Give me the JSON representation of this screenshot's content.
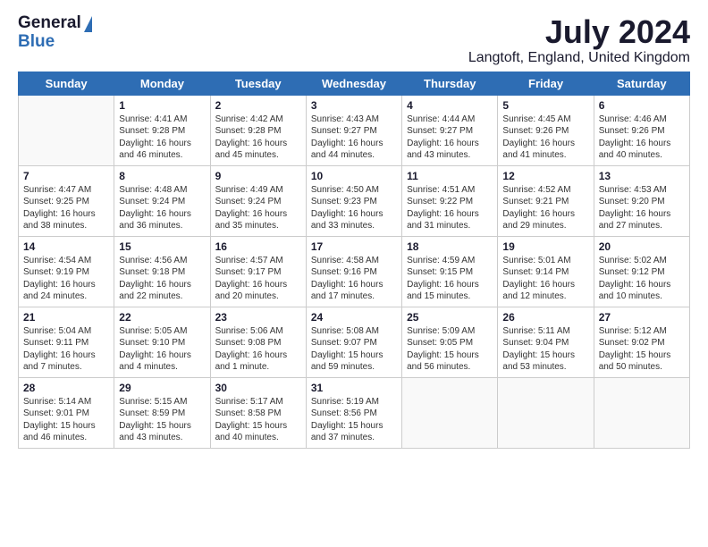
{
  "header": {
    "logo_general": "General",
    "logo_blue": "Blue",
    "month_title": "July 2024",
    "location": "Langtoft, England, United Kingdom"
  },
  "days_of_week": [
    "Sunday",
    "Monday",
    "Tuesday",
    "Wednesday",
    "Thursday",
    "Friday",
    "Saturday"
  ],
  "weeks": [
    [
      {
        "day": "",
        "info": ""
      },
      {
        "day": "1",
        "info": "Sunrise: 4:41 AM\nSunset: 9:28 PM\nDaylight: 16 hours\nand 46 minutes."
      },
      {
        "day": "2",
        "info": "Sunrise: 4:42 AM\nSunset: 9:28 PM\nDaylight: 16 hours\nand 45 minutes."
      },
      {
        "day": "3",
        "info": "Sunrise: 4:43 AM\nSunset: 9:27 PM\nDaylight: 16 hours\nand 44 minutes."
      },
      {
        "day": "4",
        "info": "Sunrise: 4:44 AM\nSunset: 9:27 PM\nDaylight: 16 hours\nand 43 minutes."
      },
      {
        "day": "5",
        "info": "Sunrise: 4:45 AM\nSunset: 9:26 PM\nDaylight: 16 hours\nand 41 minutes."
      },
      {
        "day": "6",
        "info": "Sunrise: 4:46 AM\nSunset: 9:26 PM\nDaylight: 16 hours\nand 40 minutes."
      }
    ],
    [
      {
        "day": "7",
        "info": "Sunrise: 4:47 AM\nSunset: 9:25 PM\nDaylight: 16 hours\nand 38 minutes."
      },
      {
        "day": "8",
        "info": "Sunrise: 4:48 AM\nSunset: 9:24 PM\nDaylight: 16 hours\nand 36 minutes."
      },
      {
        "day": "9",
        "info": "Sunrise: 4:49 AM\nSunset: 9:24 PM\nDaylight: 16 hours\nand 35 minutes."
      },
      {
        "day": "10",
        "info": "Sunrise: 4:50 AM\nSunset: 9:23 PM\nDaylight: 16 hours\nand 33 minutes."
      },
      {
        "day": "11",
        "info": "Sunrise: 4:51 AM\nSunset: 9:22 PM\nDaylight: 16 hours\nand 31 minutes."
      },
      {
        "day": "12",
        "info": "Sunrise: 4:52 AM\nSunset: 9:21 PM\nDaylight: 16 hours\nand 29 minutes."
      },
      {
        "day": "13",
        "info": "Sunrise: 4:53 AM\nSunset: 9:20 PM\nDaylight: 16 hours\nand 27 minutes."
      }
    ],
    [
      {
        "day": "14",
        "info": "Sunrise: 4:54 AM\nSunset: 9:19 PM\nDaylight: 16 hours\nand 24 minutes."
      },
      {
        "day": "15",
        "info": "Sunrise: 4:56 AM\nSunset: 9:18 PM\nDaylight: 16 hours\nand 22 minutes."
      },
      {
        "day": "16",
        "info": "Sunrise: 4:57 AM\nSunset: 9:17 PM\nDaylight: 16 hours\nand 20 minutes."
      },
      {
        "day": "17",
        "info": "Sunrise: 4:58 AM\nSunset: 9:16 PM\nDaylight: 16 hours\nand 17 minutes."
      },
      {
        "day": "18",
        "info": "Sunrise: 4:59 AM\nSunset: 9:15 PM\nDaylight: 16 hours\nand 15 minutes."
      },
      {
        "day": "19",
        "info": "Sunrise: 5:01 AM\nSunset: 9:14 PM\nDaylight: 16 hours\nand 12 minutes."
      },
      {
        "day": "20",
        "info": "Sunrise: 5:02 AM\nSunset: 9:12 PM\nDaylight: 16 hours\nand 10 minutes."
      }
    ],
    [
      {
        "day": "21",
        "info": "Sunrise: 5:04 AM\nSunset: 9:11 PM\nDaylight: 16 hours\nand 7 minutes."
      },
      {
        "day": "22",
        "info": "Sunrise: 5:05 AM\nSunset: 9:10 PM\nDaylight: 16 hours\nand 4 minutes."
      },
      {
        "day": "23",
        "info": "Sunrise: 5:06 AM\nSunset: 9:08 PM\nDaylight: 16 hours\nand 1 minute."
      },
      {
        "day": "24",
        "info": "Sunrise: 5:08 AM\nSunset: 9:07 PM\nDaylight: 15 hours\nand 59 minutes."
      },
      {
        "day": "25",
        "info": "Sunrise: 5:09 AM\nSunset: 9:05 PM\nDaylight: 15 hours\nand 56 minutes."
      },
      {
        "day": "26",
        "info": "Sunrise: 5:11 AM\nSunset: 9:04 PM\nDaylight: 15 hours\nand 53 minutes."
      },
      {
        "day": "27",
        "info": "Sunrise: 5:12 AM\nSunset: 9:02 PM\nDaylight: 15 hours\nand 50 minutes."
      }
    ],
    [
      {
        "day": "28",
        "info": "Sunrise: 5:14 AM\nSunset: 9:01 PM\nDaylight: 15 hours\nand 46 minutes."
      },
      {
        "day": "29",
        "info": "Sunrise: 5:15 AM\nSunset: 8:59 PM\nDaylight: 15 hours\nand 43 minutes."
      },
      {
        "day": "30",
        "info": "Sunrise: 5:17 AM\nSunset: 8:58 PM\nDaylight: 15 hours\nand 40 minutes."
      },
      {
        "day": "31",
        "info": "Sunrise: 5:19 AM\nSunset: 8:56 PM\nDaylight: 15 hours\nand 37 minutes."
      },
      {
        "day": "",
        "info": ""
      },
      {
        "day": "",
        "info": ""
      },
      {
        "day": "",
        "info": ""
      }
    ]
  ]
}
